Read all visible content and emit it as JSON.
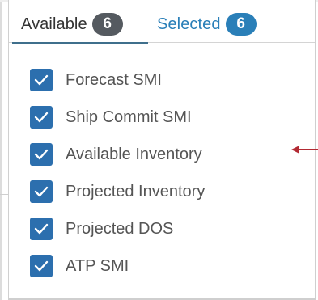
{
  "tabs": {
    "available": {
      "label": "Available",
      "count": "6"
    },
    "selected": {
      "label": "Selected",
      "count": "6"
    }
  },
  "items": [
    {
      "label": "Forecast SMI",
      "checked": true
    },
    {
      "label": "Ship Commit SMI",
      "checked": true
    },
    {
      "label": "Available Inventory",
      "checked": true
    },
    {
      "label": "Projected Inventory",
      "checked": true
    },
    {
      "label": "Projected DOS",
      "checked": true
    },
    {
      "label": "ATP SMI",
      "checked": true
    }
  ],
  "colors": {
    "checkbox": "#2c6fae",
    "selected_tab": "#2a7fb8",
    "available_badge": "#555a60",
    "active_underline": "#3f6f8c",
    "annotation_arrow": "#b22a33"
  }
}
